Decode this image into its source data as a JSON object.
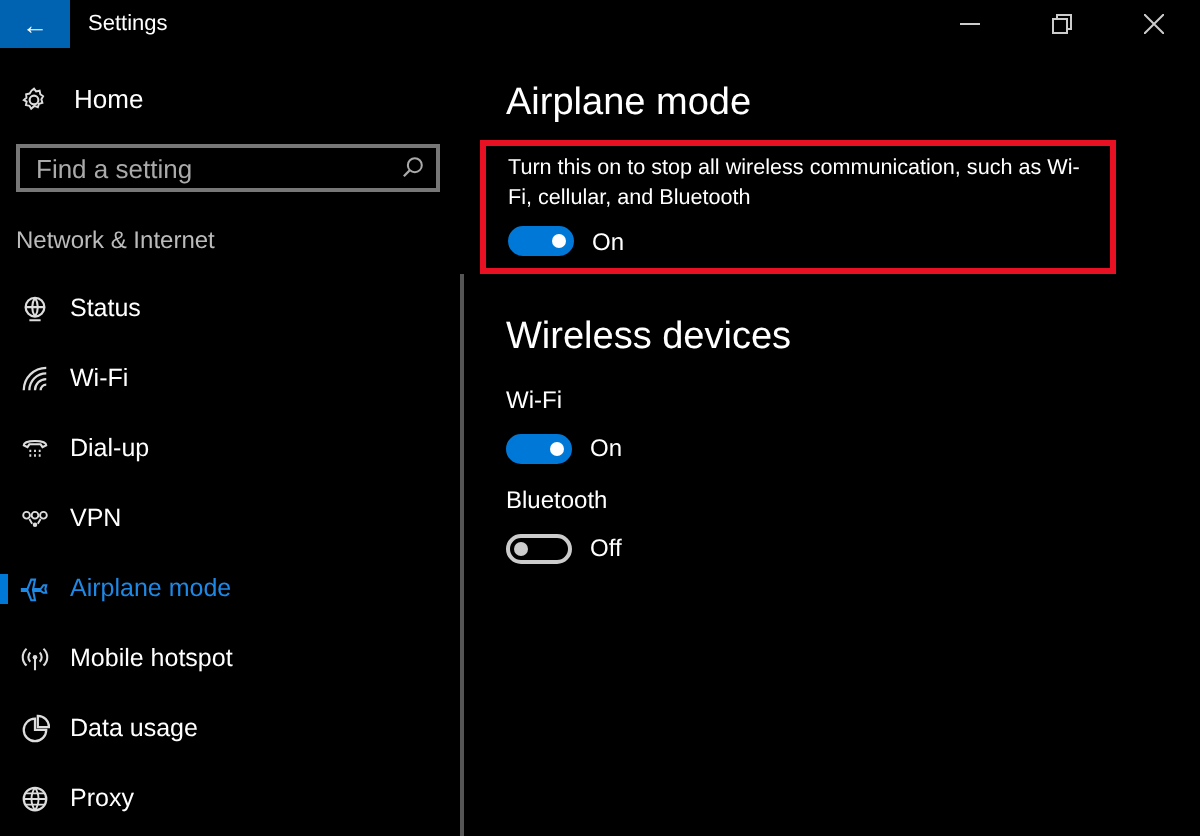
{
  "window": {
    "title": "Settings",
    "back_button": "←"
  },
  "sidebar": {
    "home": "Home",
    "search": {
      "placeholder": "Find a setting"
    },
    "section": "Network & Internet",
    "items": [
      {
        "label": "Status",
        "kind": "globe-stand",
        "selected": false
      },
      {
        "label": "Wi-Fi",
        "kind": "wifi",
        "selected": false
      },
      {
        "label": "Dial-up",
        "kind": "phone",
        "selected": false
      },
      {
        "label": "VPN",
        "kind": "vpn",
        "selected": false
      },
      {
        "label": "Airplane mode",
        "kind": "airplane",
        "selected": true
      },
      {
        "label": "Mobile hotspot",
        "kind": "hotspot",
        "selected": false
      },
      {
        "label": "Data usage",
        "kind": "pie",
        "selected": false
      },
      {
        "label": "Proxy",
        "kind": "globe",
        "selected": false
      }
    ]
  },
  "content": {
    "heading": "Airplane mode",
    "highlighted": true,
    "description": "Turn this on to stop all wireless communication, such as Wi-Fi, cellular, and Bluetooth",
    "airplane_toggle": {
      "on": true,
      "state_label": "On"
    },
    "section": "Wireless devices",
    "devices": [
      {
        "name": "Wi-Fi",
        "on": true,
        "state_label": "On"
      },
      {
        "name": "Bluetooth",
        "on": false,
        "state_label": "Off"
      }
    ]
  }
}
